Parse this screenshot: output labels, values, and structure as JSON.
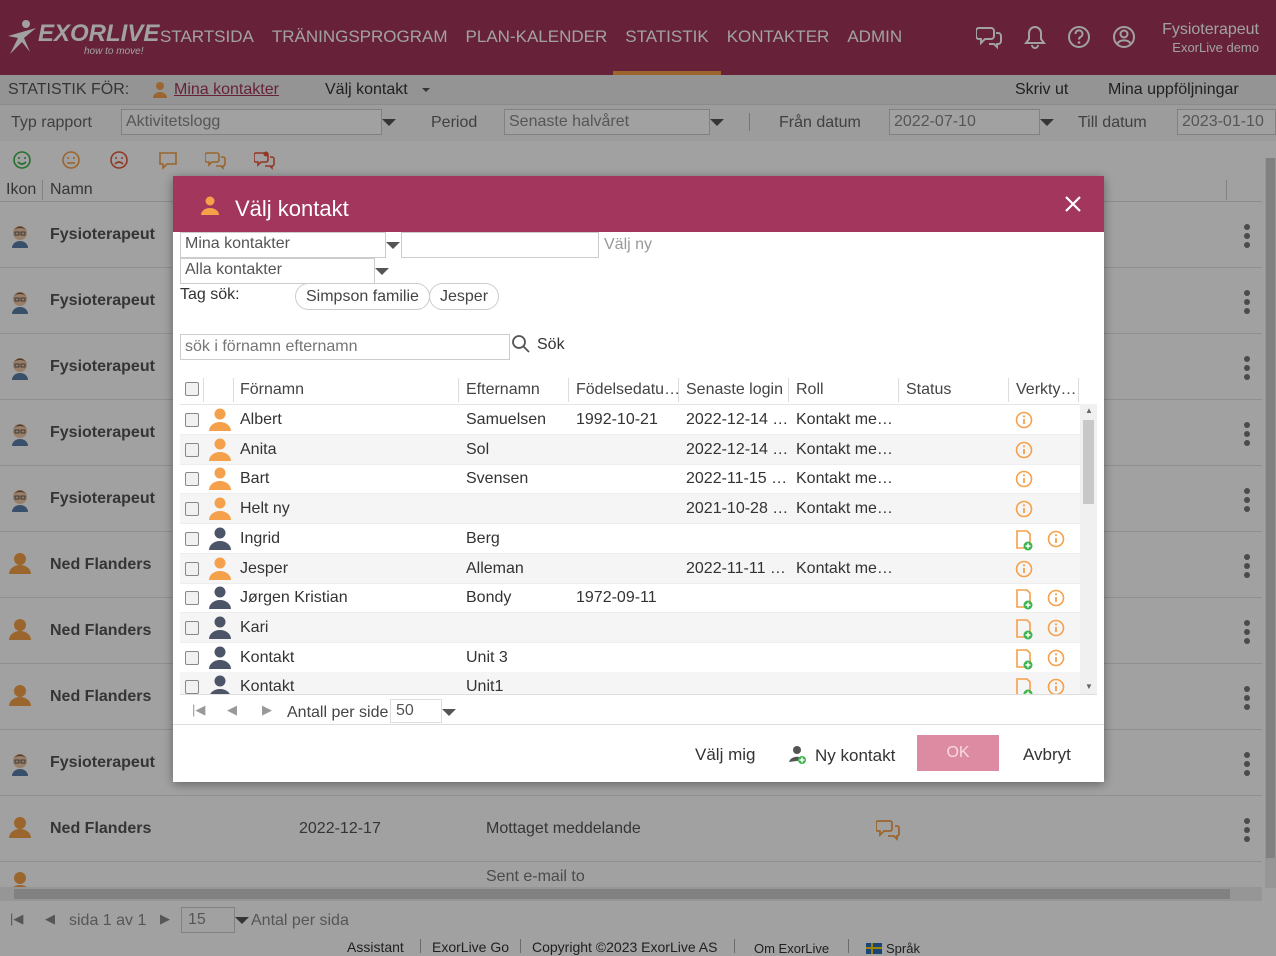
{
  "header": {
    "brand": "EXORLIVE",
    "tagline": "how to move!",
    "nav": [
      "STARTSIDA",
      "TRÄNINGSPROGRAM",
      "PLAN-KALENDER",
      "STATISTIK",
      "KONTAKTER",
      "ADMIN"
    ],
    "active_nav": "STATISTIK",
    "user_name": "Fysioterapeut",
    "user_org": "ExorLive demo"
  },
  "statbar": {
    "label": "STATISTIK FÖR:",
    "contacts_link": "Mina kontakter",
    "choose_contact": "Välj kontakt",
    "print": "Skriv ut",
    "followups": "Mina uppföljningar"
  },
  "filters": {
    "type_label": "Typ rapport",
    "type_value": "Aktivitetslogg",
    "period_label": "Period",
    "period_value": "Senaste halvåret",
    "from_label": "Från datum",
    "from_value": "2022-07-10",
    "to_label": "Till datum",
    "to_value": "2023-01-10"
  },
  "bglist": {
    "col_icon": "Ikon",
    "col_name": "Namn",
    "rows": [
      {
        "name": "Fysioterapeut"
      },
      {
        "name": "Fysioterapeut"
      },
      {
        "name": "Fysioterapeut"
      },
      {
        "name": "Fysioterapeut"
      },
      {
        "name": "Fysioterapeut"
      },
      {
        "name": "Ned Flanders"
      },
      {
        "name": "Ned Flanders"
      },
      {
        "name": "Ned Flanders"
      },
      {
        "name": "Fysioterapeut"
      },
      {
        "name": "Ned Flanders",
        "date": "2022-12-17",
        "event": "Mottaget meddelande"
      }
    ],
    "partial_row_text": "Sent e-mail to"
  },
  "bottom_pager": {
    "page_text": "sida 1 av 1",
    "per_page_value": "15",
    "per_page_label": "Antal per sida"
  },
  "footer": {
    "assistant": "Assistant",
    "go": "ExorLive Go",
    "copyright": "Copyright ©2023 ExorLive AS",
    "about": "Om ExorLive",
    "language": "Språk"
  },
  "modal": {
    "title": "Välj kontakt",
    "scope_value": "Mina kontakter",
    "new_input_value": "",
    "new_button": "Välj ny",
    "filter_value": "Alla kontakter",
    "tag_label": "Tag sök:",
    "tags": [
      "Simpson familie",
      "Jesper"
    ],
    "search_placeholder": "sök i förnamn efternamn",
    "search_button": "Sök",
    "columns": [
      "Förnamn",
      "Efternamn",
      "Födelsedatu…",
      "Senaste login",
      "Roll",
      "Status",
      "Verkty…"
    ],
    "rows": [
      {
        "first": "Albert",
        "last": "Samuelsen",
        "birth": "1992-10-21",
        "login": "2022-12-14 …",
        "role": "Kontakt me…",
        "type": "orange",
        "tools": [
          "info"
        ]
      },
      {
        "first": "Anita",
        "last": "Sol",
        "birth": "",
        "login": "2022-12-14 …",
        "role": "Kontakt me…",
        "type": "orange",
        "tools": [
          "info"
        ]
      },
      {
        "first": "Bart",
        "last": "Svensen",
        "birth": "",
        "login": "2022-11-15 …",
        "role": "Kontakt me…",
        "type": "orange",
        "tools": [
          "info"
        ]
      },
      {
        "first": "Helt ny",
        "last": "",
        "birth": "",
        "login": "2021-10-28 …",
        "role": "Kontakt me…",
        "type": "orange",
        "tools": [
          "info"
        ]
      },
      {
        "first": "Ingrid",
        "last": "Berg",
        "birth": "",
        "login": "",
        "role": "",
        "type": "gray",
        "tools": [
          "add",
          "info"
        ]
      },
      {
        "first": "Jesper",
        "last": "Alleman",
        "birth": "",
        "login": "2022-11-11 …",
        "role": "Kontakt me…",
        "type": "orange",
        "tools": [
          "info"
        ]
      },
      {
        "first": "Jørgen Kristian",
        "last": "Bondy",
        "birth": "1972-09-11",
        "login": "",
        "role": "",
        "type": "gray",
        "tools": [
          "add",
          "info"
        ]
      },
      {
        "first": "Kari",
        "last": "",
        "birth": "",
        "login": "",
        "role": "",
        "type": "gray",
        "tools": [
          "add",
          "info"
        ]
      },
      {
        "first": "Kontakt",
        "last": "Unit 3",
        "birth": "",
        "login": "",
        "role": "",
        "type": "gray",
        "tools": [
          "add",
          "info"
        ]
      },
      {
        "first": "Kontakt",
        "last": "Unit1",
        "birth": "",
        "login": "",
        "role": "",
        "type": "gray",
        "tools": [
          "add",
          "info"
        ]
      }
    ],
    "per_page_label": "Antall per side",
    "per_page_value": "50",
    "choose_me": "Välj mig",
    "new_contact": "Ny kontakt",
    "ok": "OK",
    "cancel": "Avbryt"
  },
  "colors": {
    "brand": "#a3365c",
    "accent_orange": "#f5a04a",
    "ok_disabled": "#dc8ba2"
  }
}
